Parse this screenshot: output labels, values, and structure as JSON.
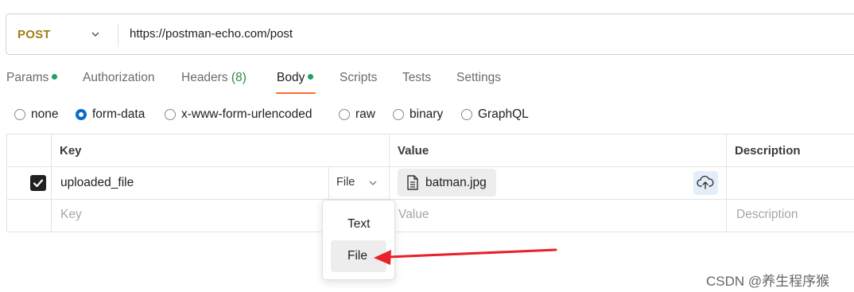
{
  "request": {
    "method": "POST",
    "url": "https://postman-echo.com/post"
  },
  "tabs": [
    {
      "label": "Params",
      "has_dot": true
    },
    {
      "label": "Authorization"
    },
    {
      "label": "Headers",
      "count": "(8)"
    },
    {
      "label": "Body",
      "has_dot": true,
      "active": true
    },
    {
      "label": "Scripts"
    },
    {
      "label": "Tests"
    },
    {
      "label": "Settings"
    }
  ],
  "body_types": [
    {
      "label": "none",
      "checked": false
    },
    {
      "label": "form-data",
      "checked": true
    },
    {
      "label": "x-www-form-urlencoded",
      "checked": false
    },
    {
      "label": "raw",
      "checked": false
    },
    {
      "label": "binary",
      "checked": false
    },
    {
      "label": "GraphQL",
      "checked": false
    }
  ],
  "table": {
    "headers": {
      "key": "Key",
      "value": "Value",
      "description": "Description"
    },
    "rows": [
      {
        "checked": true,
        "key": "uploaded_file",
        "type": "File",
        "value_file": "batman.jpg"
      }
    ],
    "placeholders": {
      "key": "Key",
      "value": "Value",
      "description": "Description"
    }
  },
  "type_dropdown": {
    "options": [
      "Text",
      "File"
    ],
    "highlighted": "File"
  },
  "annotation": {
    "arrow_color": "#e8202a"
  },
  "watermark": "CSDN @养生程序猴",
  "colors": {
    "method": "#a07d17",
    "accent": "#ff6c37",
    "radio": "#0b6bcb",
    "dot": "#19a463"
  },
  "icons": [
    "chevron-down-icon",
    "file-icon",
    "upload-cloud-icon",
    "checkmark-icon"
  ]
}
